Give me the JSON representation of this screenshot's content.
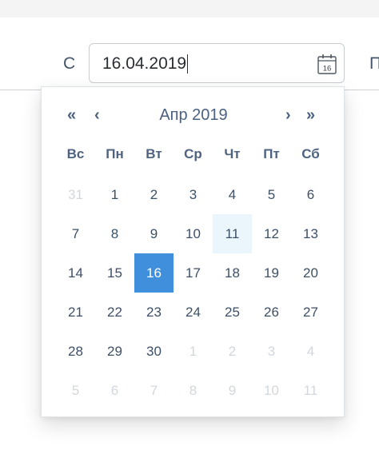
{
  "filter": {
    "from_label": "С",
    "next_label": "П",
    "date_value": "16.04.2019",
    "calendar_icon_day": "16"
  },
  "calendar": {
    "prev_year": "«",
    "prev_month": "‹",
    "title": "Апр 2019",
    "next_month": "›",
    "next_year": "»",
    "weekdays": [
      "Вс",
      "Пн",
      "Вт",
      "Ср",
      "Чт",
      "Пт",
      "Сб"
    ],
    "weeks": [
      [
        "31",
        "1",
        "2",
        "3",
        "4",
        "5",
        "6"
      ],
      [
        "7",
        "8",
        "9",
        "10",
        "11",
        "12",
        "13"
      ],
      [
        "14",
        "15",
        "16",
        "17",
        "18",
        "19",
        "20"
      ],
      [
        "21",
        "22",
        "23",
        "24",
        "25",
        "26",
        "27"
      ],
      [
        "28",
        "29",
        "30",
        "1",
        "2",
        "3",
        "4"
      ],
      [
        "5",
        "6",
        "7",
        "8",
        "9",
        "10",
        "11"
      ]
    ],
    "selected": "16",
    "today": "11"
  },
  "colors": {
    "accent": "#3f8fdc",
    "today_bg": "#eaf6fc",
    "muted": "#d3d7dc"
  }
}
